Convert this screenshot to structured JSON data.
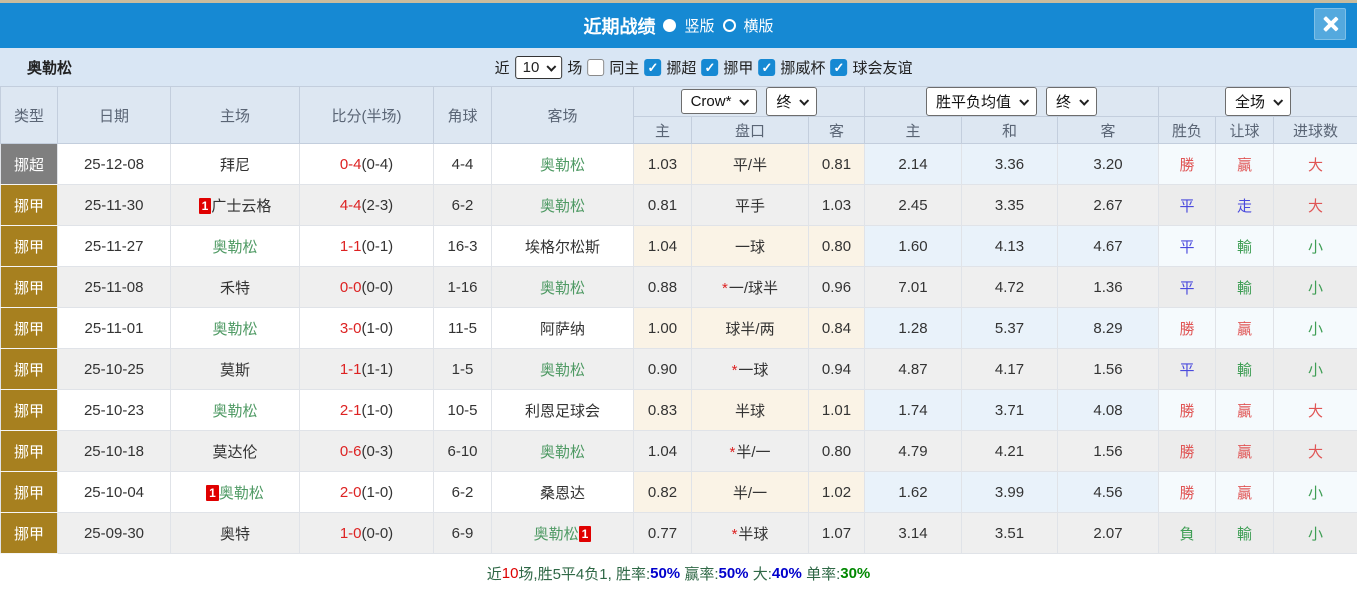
{
  "titlebar": {
    "title": "近期战绩",
    "radio_vertical_label": "竖版",
    "radio_horizontal_label": "横版",
    "selected": "竖版"
  },
  "icons": {
    "check": "✓",
    "close": "x",
    "chevron": "v"
  },
  "colors": {
    "topbar_blue": "#1689d3",
    "close_bg": "#54a9de",
    "filter_bg": "#d9e6f4",
    "header_bg": "#dde7f2",
    "league_super": "#7f7f7f",
    "league_first": "#a7801f",
    "odds_bg": "#faf3e6",
    "europe_bg": "#e9f2fa",
    "score_red": "#dd2222",
    "team_green": "#4f9a64",
    "result_red": "#e05555",
    "result_blue": "#4a4add",
    "result_green": "#3f9e55",
    "badge_red": "#e00000"
  },
  "filterbar": {
    "team": "奥勒松",
    "recent_label": "近",
    "recent_value": "10",
    "matches_label": "场",
    "same_home_label": "同主",
    "same_home_checked": false,
    "leagues": [
      "挪超",
      "挪甲",
      "挪威杯",
      "球会友谊"
    ],
    "leagues_checked": [
      true,
      true,
      true,
      true
    ]
  },
  "header": {
    "type": "类型",
    "date": "日期",
    "home": "主场",
    "score": "比分(半场)",
    "corner": "角球",
    "away": "客场",
    "odds_dropdown": "Crow*",
    "odds_state_dropdown": "终",
    "europe_dropdown": "胜平负均值",
    "europe_state_dropdown": "终",
    "scope_dropdown": "全场",
    "sub": [
      "主",
      "盘口",
      "客",
      "主",
      "和",
      "客",
      "胜负",
      "让球",
      "进球数"
    ]
  },
  "rows": [
    {
      "lg": "挪超",
      "lgt": "super",
      "date": "25-12-08",
      "home": {
        "name": "拜尼",
        "team": false
      },
      "score": {
        "f": "0-4",
        "h": "(0-4)"
      },
      "corner": "4-4",
      "away": {
        "name": "奥勒松",
        "team": true
      },
      "ho": "1.03",
      "hc": {
        "star": false,
        "text": "平/半"
      },
      "ao": "0.81",
      "w": "2.14",
      "d": "3.36",
      "l": "3.20",
      "res": {
        "t": "勝",
        "c": "r"
      },
      "hr": {
        "t": "贏",
        "c": "r"
      },
      "gl": {
        "t": "大",
        "c": "r"
      }
    },
    {
      "lg": "挪甲",
      "lgt": "first",
      "date": "25-11-30",
      "home": {
        "name": "广士云格",
        "team": false,
        "badge": "1",
        "badge_pos": "before"
      },
      "score": {
        "f": "4-4",
        "h": "(2-3)"
      },
      "corner": "6-2",
      "away": {
        "name": "奥勒松",
        "team": true
      },
      "ho": "0.81",
      "hc": {
        "star": false,
        "text": "平手"
      },
      "ao": "1.03",
      "w": "2.45",
      "d": "3.35",
      "l": "2.67",
      "res": {
        "t": "平",
        "c": "b"
      },
      "hr": {
        "t": "走",
        "c": "b"
      },
      "gl": {
        "t": "大",
        "c": "r"
      }
    },
    {
      "lg": "挪甲",
      "lgt": "first",
      "date": "25-11-27",
      "home": {
        "name": "奥勒松",
        "team": true
      },
      "score": {
        "f": "1-1",
        "h": "(0-1)"
      },
      "corner": "16-3",
      "away": {
        "name": "埃格尔松斯",
        "team": false
      },
      "ho": "1.04",
      "hc": {
        "star": false,
        "text": "一球"
      },
      "ao": "0.80",
      "w": "1.60",
      "d": "4.13",
      "l": "4.67",
      "res": {
        "t": "平",
        "c": "b"
      },
      "hr": {
        "t": "輸",
        "c": "g"
      },
      "gl": {
        "t": "小",
        "c": "g"
      }
    },
    {
      "lg": "挪甲",
      "lgt": "first",
      "date": "25-11-08",
      "home": {
        "name": "禾特",
        "team": false
      },
      "score": {
        "f": "0-0",
        "h": "(0-0)"
      },
      "corner": "1-16",
      "away": {
        "name": "奥勒松",
        "team": true
      },
      "ho": "0.88",
      "hc": {
        "star": true,
        "text": "一/球半"
      },
      "ao": "0.96",
      "w": "7.01",
      "d": "4.72",
      "l": "1.36",
      "res": {
        "t": "平",
        "c": "b"
      },
      "hr": {
        "t": "輸",
        "c": "g"
      },
      "gl": {
        "t": "小",
        "c": "g"
      }
    },
    {
      "lg": "挪甲",
      "lgt": "first",
      "date": "25-11-01",
      "home": {
        "name": "奥勒松",
        "team": true
      },
      "score": {
        "f": "3-0",
        "h": "(1-0)"
      },
      "corner": "11-5",
      "away": {
        "name": "阿萨纳",
        "team": false
      },
      "ho": "1.00",
      "hc": {
        "star": false,
        "text": "球半/两"
      },
      "ao": "0.84",
      "w": "1.28",
      "d": "5.37",
      "l": "8.29",
      "res": {
        "t": "勝",
        "c": "r"
      },
      "hr": {
        "t": "贏",
        "c": "r"
      },
      "gl": {
        "t": "小",
        "c": "g"
      }
    },
    {
      "lg": "挪甲",
      "lgt": "first",
      "date": "25-10-25",
      "home": {
        "name": "莫斯",
        "team": false
      },
      "score": {
        "f": "1-1",
        "h": "(1-1)"
      },
      "corner": "1-5",
      "away": {
        "name": "奥勒松",
        "team": true
      },
      "ho": "0.90",
      "hc": {
        "star": true,
        "text": "一球"
      },
      "ao": "0.94",
      "w": "4.87",
      "d": "4.17",
      "l": "1.56",
      "res": {
        "t": "平",
        "c": "b"
      },
      "hr": {
        "t": "輸",
        "c": "g"
      },
      "gl": {
        "t": "小",
        "c": "g"
      }
    },
    {
      "lg": "挪甲",
      "lgt": "first",
      "date": "25-10-23",
      "home": {
        "name": "奥勒松",
        "team": true
      },
      "score": {
        "f": "2-1",
        "h": "(1-0)"
      },
      "corner": "10-5",
      "away": {
        "name": "利恩足球会",
        "team": false
      },
      "ho": "0.83",
      "hc": {
        "star": false,
        "text": "半球"
      },
      "ao": "1.01",
      "w": "1.74",
      "d": "3.71",
      "l": "4.08",
      "res": {
        "t": "勝",
        "c": "r"
      },
      "hr": {
        "t": "贏",
        "c": "r"
      },
      "gl": {
        "t": "大",
        "c": "r"
      }
    },
    {
      "lg": "挪甲",
      "lgt": "first",
      "date": "25-10-18",
      "home": {
        "name": "莫达伦",
        "team": false
      },
      "score": {
        "f": "0-6",
        "h": "(0-3)"
      },
      "corner": "6-10",
      "away": {
        "name": "奥勒松",
        "team": true
      },
      "ho": "1.04",
      "hc": {
        "star": true,
        "text": "半/一"
      },
      "ao": "0.80",
      "w": "4.79",
      "d": "4.21",
      "l": "1.56",
      "res": {
        "t": "勝",
        "c": "r"
      },
      "hr": {
        "t": "贏",
        "c": "r"
      },
      "gl": {
        "t": "大",
        "c": "r"
      }
    },
    {
      "lg": "挪甲",
      "lgt": "first",
      "date": "25-10-04",
      "home": {
        "name": "奥勒松",
        "team": true,
        "badge": "1",
        "badge_pos": "before"
      },
      "score": {
        "f": "2-0",
        "h": "(1-0)"
      },
      "corner": "6-2",
      "away": {
        "name": "桑恩达",
        "team": false
      },
      "ho": "0.82",
      "hc": {
        "star": false,
        "text": "半/一"
      },
      "ao": "1.02",
      "w": "1.62",
      "d": "3.99",
      "l": "4.56",
      "res": {
        "t": "勝",
        "c": "r"
      },
      "hr": {
        "t": "贏",
        "c": "r"
      },
      "gl": {
        "t": "小",
        "c": "g"
      }
    },
    {
      "lg": "挪甲",
      "lgt": "first",
      "date": "25-09-30",
      "home": {
        "name": "奥特",
        "team": false
      },
      "score": {
        "f": "1-0",
        "h": "(0-0)"
      },
      "corner": "6-9",
      "away": {
        "name": "奥勒松",
        "team": true,
        "badge": "1",
        "badge_pos": "after"
      },
      "ho": "0.77",
      "hc": {
        "star": true,
        "text": "半球"
      },
      "ao": "1.07",
      "w": "3.14",
      "d": "3.51",
      "l": "2.07",
      "res": {
        "t": "負",
        "c": "g"
      },
      "hr": {
        "t": "輸",
        "c": "g"
      },
      "gl": {
        "t": "小",
        "c": "g"
      }
    }
  ],
  "summary": {
    "segments": [
      {
        "t": "近",
        "c": "label"
      },
      {
        "t": "10",
        "c": "red"
      },
      {
        "t": "场,胜5平4负1, 胜率:",
        "c": "label"
      },
      {
        "t": "50%",
        "c": "blue"
      },
      {
        "t": " 赢率:",
        "c": "label"
      },
      {
        "t": "50%",
        "c": "blue"
      },
      {
        "t": " 大:",
        "c": "label"
      },
      {
        "t": "40%",
        "c": "blue"
      },
      {
        "t": " 单率:",
        "c": "label"
      },
      {
        "t": "30%",
        "c": "green"
      }
    ]
  }
}
